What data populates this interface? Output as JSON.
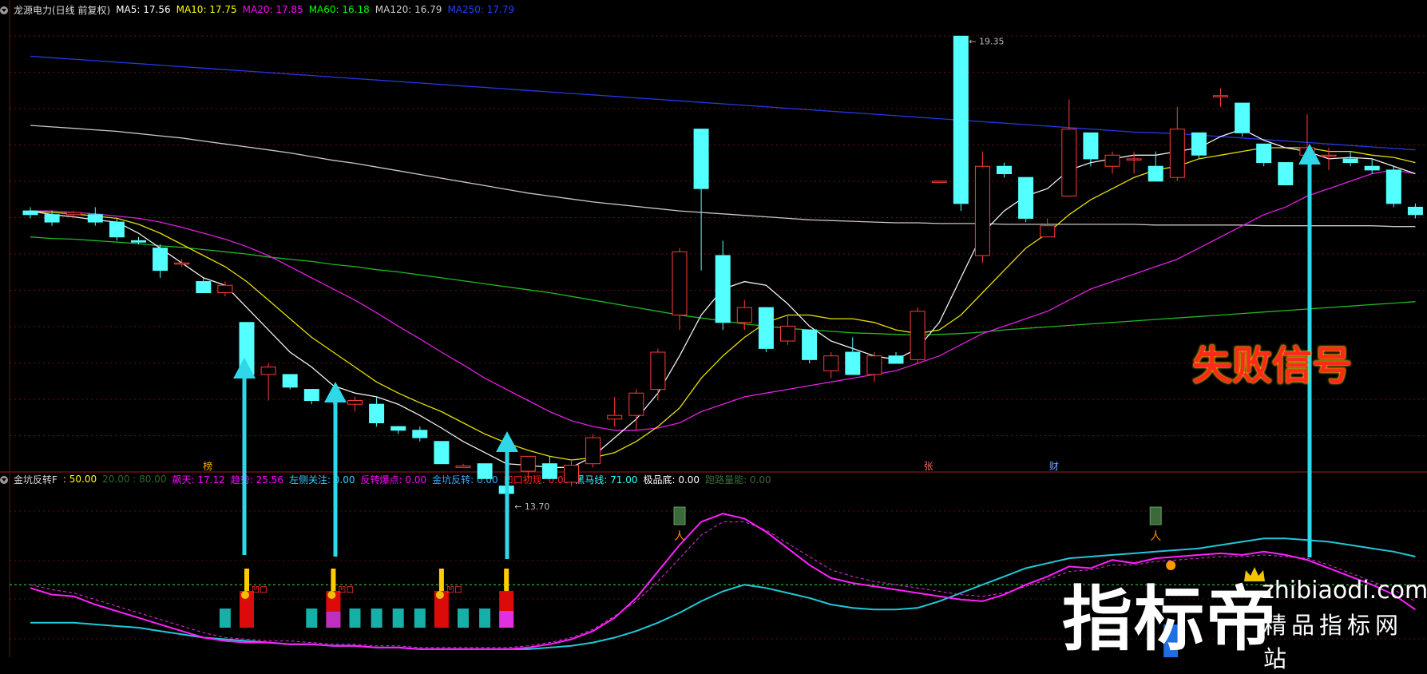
{
  "main_legend": {
    "title": "龙源电力(日线 前复权)",
    "items": [
      {
        "label": "MA5: 17.56",
        "color": "#ffffff"
      },
      {
        "label": "MA10: 17.75",
        "color": "#ffff00"
      },
      {
        "label": "MA20: 17.85",
        "color": "#ff00ff"
      },
      {
        "label": "MA60: 16.18",
        "color": "#00ff00"
      },
      {
        "label": "MA120: 16.79",
        "color": "#cccccc"
      },
      {
        "label": "MA250: 17.79",
        "color": "#2040ff"
      }
    ]
  },
  "indicator_legend": {
    "title": "金坑反转F",
    "items": [
      {
        "label": ": 50.00",
        "color": "#ffff00"
      },
      {
        "label": "20.00 : 80.00",
        "color": "#2a6a2a"
      },
      {
        "label": "飙天: 17.12",
        "color": "#ff00ff"
      },
      {
        "label": "趋势: 25.56",
        "color": "#ff00ff"
      },
      {
        "label": "左侧关注: 0.00",
        "color": "#33ccff"
      },
      {
        "label": "反转爆点: 0.00",
        "color": "#ff00ff"
      },
      {
        "label": "金坑反转: 0.00",
        "color": "#33aaff"
      },
      {
        "label": "凹口初现: 0.00",
        "color": "#ff2020"
      },
      {
        "label": "黑马线: 71.00",
        "color": "#33ffff"
      },
      {
        "label": "极品底: 0.00",
        "color": "#ffffff"
      },
      {
        "label": "跑路量能: 0.00",
        "color": "#3a6a3a"
      }
    ]
  },
  "price_labels": {
    "high": "19.35",
    "low": "13.70"
  },
  "chart_markers": {
    "m1": "榜",
    "m2": "张",
    "m3": "财"
  },
  "annotation": "失败信号",
  "watermark": {
    "brand": "指标帝",
    "url": "zhibiaodi.com",
    "slogan": "精品指标网站"
  },
  "signal_tag": "凹口",
  "chart_data": {
    "type": "candlestick",
    "ylim": [
      13.5,
      19.6
    ],
    "candles": [
      [
        17.0,
        17.05,
        16.9,
        16.95
      ],
      [
        16.95,
        17.0,
        16.8,
        16.85
      ],
      [
        16.95,
        17.0,
        16.9,
        16.98
      ],
      [
        16.95,
        17.05,
        16.8,
        16.85
      ],
      [
        16.85,
        16.9,
        16.6,
        16.65
      ],
      [
        16.6,
        16.65,
        16.55,
        16.58
      ],
      [
        16.5,
        16.55,
        16.1,
        16.2
      ],
      [
        16.3,
        16.35,
        16.25,
        16.3
      ],
      [
        16.05,
        16.1,
        15.9,
        15.9
      ],
      [
        15.9,
        16.05,
        15.85,
        16.0
      ],
      [
        15.5,
        15.5,
        14.75,
        14.8
      ],
      [
        14.8,
        14.95,
        14.45,
        14.9
      ],
      [
        14.8,
        14.8,
        14.6,
        14.63
      ],
      [
        14.6,
        14.6,
        14.4,
        14.45
      ],
      [
        14.45,
        14.5,
        14.4,
        14.45
      ],
      [
        14.4,
        14.5,
        14.3,
        14.45
      ],
      [
        14.4,
        14.5,
        14.1,
        14.15
      ],
      [
        14.1,
        14.1,
        14.0,
        14.05
      ],
      [
        14.05,
        14.1,
        13.9,
        13.95
      ],
      [
        13.9,
        13.9,
        13.6,
        13.6
      ],
      [
        13.55,
        13.6,
        13.55,
        13.57
      ],
      [
        13.6,
        13.6,
        13.4,
        13.4
      ],
      [
        13.3,
        13.35,
        13.2,
        13.2
      ],
      [
        13.5,
        13.7,
        13.4,
        13.7
      ],
      [
        13.6,
        13.7,
        13.4,
        13.4
      ],
      [
        13.35,
        13.65,
        13.3,
        13.58
      ],
      [
        13.6,
        14.0,
        13.55,
        13.95
      ],
      [
        14.2,
        14.5,
        14.1,
        14.25
      ],
      [
        14.25,
        14.6,
        14.05,
        14.55
      ],
      [
        14.6,
        15.15,
        14.45,
        15.1
      ],
      [
        15.6,
        16.5,
        15.4,
        16.45
      ],
      [
        18.1,
        18.1,
        16.2,
        17.3
      ],
      [
        16.4,
        16.6,
        15.4,
        15.5
      ],
      [
        15.5,
        15.8,
        15.4,
        15.7
      ],
      [
        15.7,
        15.7,
        15.1,
        15.15
      ],
      [
        15.25,
        15.6,
        15.2,
        15.45
      ],
      [
        15.4,
        15.4,
        14.95,
        15.0
      ],
      [
        14.85,
        15.1,
        14.75,
        15.05
      ],
      [
        15.1,
        15.3,
        14.8,
        14.8
      ],
      [
        14.8,
        15.1,
        14.7,
        15.05
      ],
      [
        15.05,
        15.1,
        14.95,
        14.95
      ],
      [
        15.0,
        15.7,
        14.95,
        15.65
      ],
      [
        17.4,
        17.4,
        17.4,
        17.4
      ],
      [
        19.35,
        19.35,
        17.0,
        17.1
      ],
      [
        16.4,
        17.8,
        16.3,
        17.6
      ],
      [
        17.6,
        17.65,
        17.45,
        17.5
      ],
      [
        17.45,
        17.45,
        16.85,
        16.9
      ],
      [
        16.65,
        16.9,
        16.65,
        16.8
      ],
      [
        17.2,
        18.5,
        17.2,
        18.1
      ],
      [
        18.05,
        18.05,
        17.6,
        17.7
      ],
      [
        17.6,
        17.8,
        17.5,
        17.75
      ],
      [
        17.7,
        17.8,
        17.5,
        17.7
      ],
      [
        17.6,
        17.8,
        17.4,
        17.4
      ],
      [
        17.45,
        18.4,
        17.4,
        18.1
      ],
      [
        18.05,
        18.05,
        17.7,
        17.75
      ],
      [
        18.55,
        18.65,
        18.4,
        18.55
      ],
      [
        18.45,
        18.45,
        18.0,
        18.05
      ],
      [
        17.9,
        17.9,
        17.6,
        17.65
      ],
      [
        17.65,
        17.65,
        17.35,
        17.35
      ],
      [
        17.75,
        18.3,
        17.7,
        17.85
      ],
      [
        17.75,
        17.85,
        17.55,
        17.75
      ],
      [
        17.7,
        17.8,
        17.6,
        17.65
      ],
      [
        17.6,
        17.7,
        17.5,
        17.55
      ],
      [
        17.55,
        17.6,
        17.05,
        17.1
      ],
      [
        17.05,
        17.1,
        16.9,
        16.95
      ]
    ],
    "ma5": [
      17.0,
      16.95,
      16.92,
      16.88,
      16.85,
      16.7,
      16.5,
      16.3,
      16.1,
      16.0,
      15.7,
      15.4,
      15.1,
      14.9,
      14.65,
      14.55,
      14.5,
      14.4,
      14.25,
      14.08,
      13.9,
      13.75,
      13.6,
      13.58,
      13.55,
      13.55,
      13.7,
      13.95,
      14.2,
      14.55,
      15.05,
      15.6,
      15.95,
      16.05,
      16.0,
      15.75,
      15.45,
      15.25,
      15.15,
      15.05,
      15.0,
      15.15,
      15.5,
      16.1,
      16.7,
      17.0,
      17.2,
      17.3,
      17.55,
      17.65,
      17.7,
      17.75,
      17.75,
      17.8,
      17.85,
      18.0,
      18.1,
      17.95,
      17.85,
      17.8,
      17.7,
      17.72,
      17.7,
      17.6,
      17.5
    ],
    "ma10": [
      17.0,
      16.98,
      16.96,
      16.93,
      16.9,
      16.82,
      16.7,
      16.55,
      16.4,
      16.25,
      16.05,
      15.8,
      15.55,
      15.3,
      15.1,
      14.9,
      14.7,
      14.55,
      14.42,
      14.3,
      14.15,
      14.0,
      13.88,
      13.78,
      13.7,
      13.65,
      13.68,
      13.75,
      13.9,
      14.1,
      14.35,
      14.75,
      15.05,
      15.3,
      15.5,
      15.6,
      15.6,
      15.55,
      15.55,
      15.5,
      15.4,
      15.35,
      15.4,
      15.6,
      15.9,
      16.2,
      16.5,
      16.7,
      16.95,
      17.15,
      17.3,
      17.45,
      17.55,
      17.6,
      17.7,
      17.75,
      17.8,
      17.85,
      17.85,
      17.85,
      17.8,
      17.8,
      17.75,
      17.72,
      17.65
    ],
    "ma20": [
      17.0,
      17.0,
      16.98,
      16.96,
      16.93,
      16.9,
      16.85,
      16.78,
      16.7,
      16.62,
      16.52,
      16.4,
      16.25,
      16.1,
      15.95,
      15.8,
      15.63,
      15.45,
      15.28,
      15.1,
      14.93,
      14.75,
      14.6,
      14.45,
      14.3,
      14.18,
      14.1,
      14.05,
      14.05,
      14.08,
      14.15,
      14.3,
      14.4,
      14.5,
      14.55,
      14.6,
      14.65,
      14.7,
      14.75,
      14.8,
      14.85,
      14.95,
      15.05,
      15.2,
      15.35,
      15.45,
      15.55,
      15.65,
      15.8,
      15.95,
      16.05,
      16.15,
      16.25,
      16.35,
      16.5,
      16.65,
      16.8,
      16.95,
      17.05,
      17.2,
      17.3,
      17.4,
      17.5,
      17.55,
      17.5
    ],
    "ma60": [
      16.65,
      16.63,
      16.62,
      16.6,
      16.58,
      16.56,
      16.53,
      16.51,
      16.48,
      16.45,
      16.42,
      16.38,
      16.35,
      16.32,
      16.28,
      16.25,
      16.21,
      16.18,
      16.14,
      16.1,
      16.06,
      16.02,
      15.98,
      15.94,
      15.9,
      15.85,
      15.8,
      15.75,
      15.7,
      15.65,
      15.6,
      15.56,
      15.52,
      15.48,
      15.45,
      15.42,
      15.4,
      15.38,
      15.36,
      15.35,
      15.34,
      15.33,
      15.34,
      15.35,
      15.37,
      15.4,
      15.42,
      15.44,
      15.46,
      15.48,
      15.5,
      15.52,
      15.54,
      15.56,
      15.58,
      15.6,
      15.62,
      15.64,
      15.66,
      15.68,
      15.7,
      15.72,
      15.74,
      15.76,
      15.78
    ],
    "ma120": [
      18.15,
      18.13,
      18.11,
      18.09,
      18.07,
      18.04,
      18.01,
      17.98,
      17.94,
      17.9,
      17.86,
      17.82,
      17.78,
      17.73,
      17.68,
      17.64,
      17.59,
      17.54,
      17.49,
      17.44,
      17.39,
      17.34,
      17.29,
      17.24,
      17.2,
      17.16,
      17.12,
      17.09,
      17.06,
      17.03,
      17.0,
      16.98,
      16.96,
      16.94,
      16.92,
      16.9,
      16.88,
      16.87,
      16.86,
      16.85,
      16.84,
      16.84,
      16.83,
      16.83,
      16.83,
      16.82,
      16.82,
      16.82,
      16.82,
      16.82,
      16.82,
      16.82,
      16.81,
      16.81,
      16.81,
      16.81,
      16.81,
      16.8,
      16.8,
      16.8,
      16.8,
      16.8,
      16.8,
      16.79,
      16.79
    ],
    "ma250": [
      19.08,
      19.06,
      19.04,
      19.02,
      19.0,
      18.98,
      18.96,
      18.94,
      18.92,
      18.9,
      18.88,
      18.86,
      18.84,
      18.82,
      18.8,
      18.78,
      18.76,
      18.74,
      18.72,
      18.7,
      18.68,
      18.66,
      18.64,
      18.62,
      18.6,
      18.58,
      18.56,
      18.54,
      18.52,
      18.5,
      18.48,
      18.46,
      18.44,
      18.42,
      18.4,
      18.38,
      18.36,
      18.34,
      18.32,
      18.3,
      18.28,
      18.26,
      18.24,
      18.22,
      18.2,
      18.18,
      18.16,
      18.14,
      18.12,
      18.1,
      18.08,
      18.06,
      18.05,
      18.04,
      18.02,
      18.0,
      17.98,
      17.96,
      17.94,
      17.92,
      17.9,
      17.88,
      17.86,
      17.84,
      17.82
    ],
    "indicator": {
      "ylim": [
        0,
        100
      ],
      "magenta": [
        38,
        34,
        33,
        28,
        24,
        20,
        16,
        12,
        8,
        6,
        5,
        5,
        4,
        4,
        3,
        3,
        2,
        2,
        1,
        1,
        1,
        1,
        1,
        2,
        4,
        7,
        12,
        20,
        32,
        48,
        64,
        78,
        83,
        80,
        72,
        62,
        52,
        44,
        41,
        39,
        37,
        35,
        33,
        31,
        30,
        34,
        40,
        45,
        51,
        50,
        55,
        53,
        56,
        57,
        58,
        59,
        58,
        60,
        58,
        55,
        50,
        45,
        40,
        34,
        25
      ],
      "dashed": [
        40,
        37,
        35,
        31,
        27,
        23,
        19,
        15,
        11,
        8,
        7,
        6,
        6,
        5,
        4,
        4,
        3,
        3,
        2,
        2,
        2,
        2,
        2,
        3,
        5,
        8,
        13,
        21,
        30,
        42,
        56,
        70,
        78,
        78,
        73,
        65,
        57,
        49,
        45,
        42,
        40,
        38,
        36,
        34,
        33,
        35,
        39,
        43,
        48,
        49,
        52,
        52,
        54,
        55,
        56,
        57,
        57,
        58,
        57,
        56,
        52,
        47,
        42,
        37,
        30
      ],
      "cyan": [
        17,
        17,
        17,
        16,
        15,
        14,
        12,
        10,
        8,
        7,
        6,
        5,
        4,
        4,
        3,
        3,
        2,
        2,
        1,
        1,
        1,
        1,
        1,
        1,
        2,
        3,
        5,
        8,
        12,
        17,
        23,
        30,
        36,
        40,
        38,
        35,
        32,
        28,
        26,
        25,
        25,
        26,
        30,
        35,
        40,
        45,
        50,
        53,
        56,
        57,
        58,
        59,
        60,
        61,
        62,
        64,
        66,
        68,
        68,
        67,
        66,
        64,
        62,
        60,
        57
      ],
      "dotted_level": 40,
      "bars": [
        {
          "i": 9,
          "type": "cyan"
        },
        {
          "i": 10,
          "type": "red",
          "mark": "钱"
        },
        {
          "i": 13,
          "type": "cyan"
        },
        {
          "i": 14,
          "type": "red-tall",
          "mark": "钱"
        },
        {
          "i": 15,
          "type": "cyan"
        },
        {
          "i": 16,
          "type": "cyan"
        },
        {
          "i": 17,
          "type": "cyan"
        },
        {
          "i": 18,
          "type": "cyan"
        },
        {
          "i": 19,
          "type": "red",
          "mark": "钱"
        },
        {
          "i": 20,
          "type": "cyan"
        },
        {
          "i": 21,
          "type": "cyan"
        },
        {
          "i": 22,
          "type": "magenta-tall"
        }
      ],
      "green_bars": [
        30,
        52
      ]
    }
  }
}
